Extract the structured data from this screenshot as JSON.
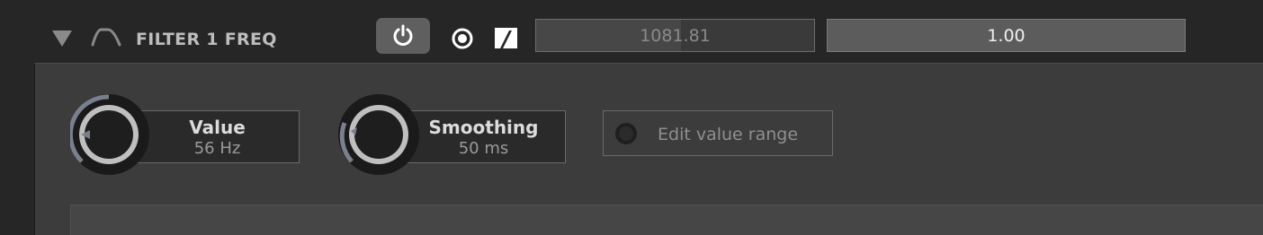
{
  "header": {
    "title": "FILTER 1 FREQ",
    "value_field": "1081.81",
    "value_fill_fraction": 0.52,
    "amount_field": "1.00"
  },
  "icons": {
    "collapse": "triangle-down-icon",
    "filter_shape": "bandpass-filter-icon",
    "power": "power-icon",
    "record": "record-icon",
    "modulation": "modulation-icon"
  },
  "params": {
    "value": {
      "name": "Value",
      "value": "56 Hz"
    },
    "smoothing": {
      "name": "Smoothing",
      "value": "50 ms"
    }
  },
  "edit_range": {
    "label": "Edit value range"
  },
  "colors": {
    "panel": "#3c3c3c",
    "header": "#262626",
    "knob_ring": "#bfbfbf",
    "knob_arc": "#7a7f8f"
  }
}
